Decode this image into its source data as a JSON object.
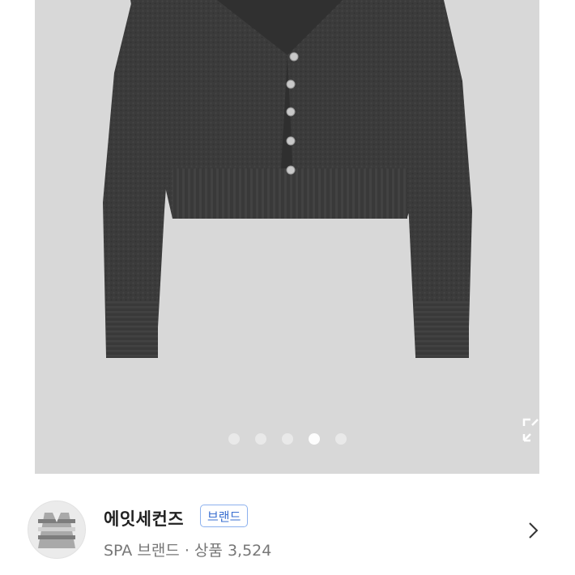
{
  "product": {
    "carousel": {
      "total": 5,
      "active_index": 3
    }
  },
  "brand": {
    "name": "에잇세컨즈",
    "badge": "브랜드",
    "category": "SPA 브랜드",
    "separator": "·",
    "products_label": "상품",
    "products_count": "3,524"
  }
}
